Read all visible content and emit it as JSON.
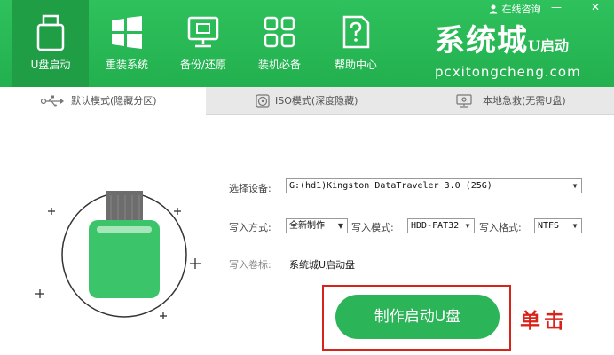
{
  "nav": {
    "items": [
      {
        "label": "U盘启动",
        "icon": "usb-drive-icon",
        "active": true
      },
      {
        "label": "重装系统",
        "icon": "windows-icon"
      },
      {
        "label": "备份/还原",
        "icon": "backup-restore-icon"
      },
      {
        "label": "装机必备",
        "icon": "apps-grid-icon"
      },
      {
        "label": "帮助中心",
        "icon": "help-document-icon"
      }
    ]
  },
  "topbar": {
    "consult_label": "在线咨询",
    "minimize_symbol": "—",
    "close_symbol": "✕"
  },
  "logo": {
    "main": "系统城",
    "sub": "U启动",
    "url": "pcxitongcheng.com"
  },
  "tabs": [
    {
      "label": "默认模式(隐藏分区)",
      "icon": "usb-plug-icon",
      "active": true
    },
    {
      "label": "ISO模式(深度隐藏)",
      "icon": "disc-icon"
    },
    {
      "label": "本地急救(无需U盘)",
      "icon": "monitor-icon"
    }
  ],
  "form": {
    "device_label": "选择设备:",
    "device_value": "G:(hd1)Kingston DataTraveler 3.0 (25G)",
    "write_method_label": "写入方式:",
    "write_method_value": "全新制作",
    "write_mode_label": "写入模式:",
    "write_mode_value": "HDD-FAT32",
    "write_format_label": "写入格式:",
    "write_format_value": "NTFS",
    "volume_label": "写入卷标:",
    "volume_value": "系统城U启动盘"
  },
  "start_button_label": "制作启动U盘",
  "annotation": "单击",
  "colors": {
    "brand_green": "#2bb558",
    "annotation_red": "#d8231b"
  }
}
